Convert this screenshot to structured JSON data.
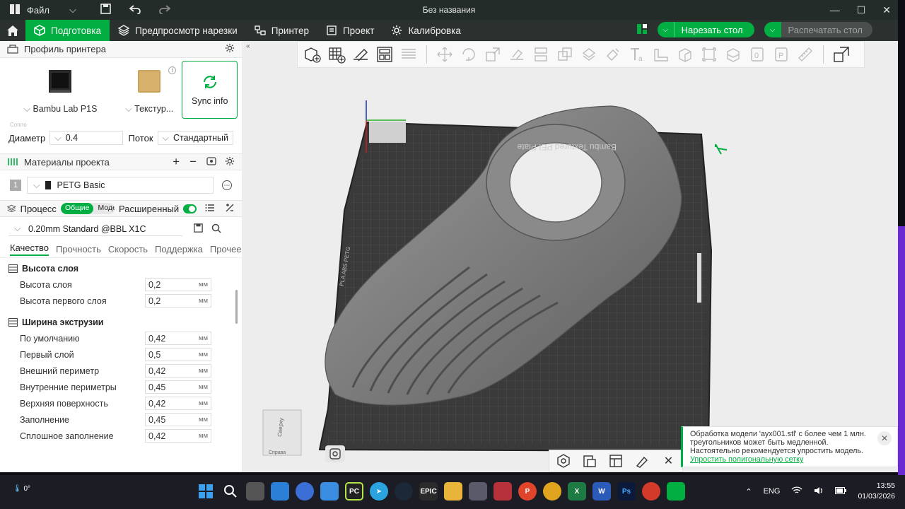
{
  "titlebar": {
    "file_menu": "Файл",
    "title": "Без названия",
    "minimize": "—",
    "maximize": "☐",
    "close": "✕"
  },
  "toolbar": {
    "tabs": [
      {
        "label": "Подготовка",
        "active": true
      },
      {
        "label": "Предпросмотр нарезки",
        "active": false
      },
      {
        "label": "Принтер",
        "active": false
      },
      {
        "label": "Проект",
        "active": false
      },
      {
        "label": "Калибровка",
        "active": false
      }
    ],
    "slice_button": "Нарезать стол",
    "print_button": "Распечатать стол"
  },
  "printer_section": {
    "title": "Профиль принтера",
    "printer_name": "Bambu Lab P1S",
    "plate_name": "Текстур...",
    "sync_label": "Sync info",
    "nozzle_label": "Сопло",
    "diameter_label": "Диаметр",
    "diameter_value": "0.4",
    "flow_label": "Поток",
    "flow_value": "Стандартный"
  },
  "materials_section": {
    "title": "Материалы проекта",
    "items": [
      {
        "index": "1",
        "name": "PETG Basic"
      }
    ]
  },
  "process_section": {
    "title": "Процесс",
    "pill_general": "Общие",
    "pill_models": "Модели",
    "advanced_label": "Расширенный",
    "preset": "0.20mm Standard @BBL X1C",
    "tabs": [
      "Качество",
      "Прочность",
      "Скорость",
      "Поддержка",
      "Прочее"
    ],
    "groups": [
      {
        "title": "Высота слоя",
        "rows": [
          {
            "label": "Высота слоя",
            "value": "0,2",
            "unit": "мм"
          },
          {
            "label": "Высота первого слоя",
            "value": "0,2",
            "unit": "мм"
          }
        ]
      },
      {
        "title": "Ширина экструзии",
        "rows": [
          {
            "label": "По умолчанию",
            "value": "0,42",
            "unit": "мм"
          },
          {
            "label": "Первый слой",
            "value": "0,5",
            "unit": "мм"
          },
          {
            "label": "Внешний периметр",
            "value": "0,42",
            "unit": "мм"
          },
          {
            "label": "Внутренние периметры",
            "value": "0,45",
            "unit": "мм"
          },
          {
            "label": "Верхняя поверхность",
            "value": "0,42",
            "unit": "мм"
          },
          {
            "label": "Заполнение",
            "value": "0,45",
            "unit": "мм"
          },
          {
            "label": "Сплошное заполнение",
            "value": "0,42",
            "unit": "мм"
          }
        ]
      }
    ]
  },
  "viewport": {
    "plate_text": "Bambu Textured PEI Plate",
    "plate_side_text": "PLA ABS PETG",
    "view_cube_top": "Сверху",
    "view_cube_right": "Справа"
  },
  "notification": {
    "text1": "Обработка модели 'аух001.stl' с более чем 1 млн.",
    "text2": "треугольников может быть медленной.",
    "text3": "Настоятельно рекомендуется упростить модель.",
    "link": "Упростить полигональную сетку"
  },
  "taskbar": {
    "weather": "0°",
    "lang": "ENG",
    "time": "13:55",
    "date": "01/03/2026"
  },
  "colors": {
    "accent": "#00ae42",
    "titlebar": "#232c29",
    "toolbar": "#2b312f"
  }
}
